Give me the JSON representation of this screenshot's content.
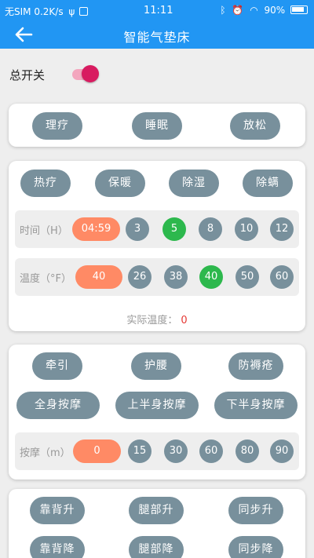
{
  "status_bar": {
    "carrier": "无SIM 0.2K/s",
    "time": "11:11",
    "battery": "90%"
  },
  "app_bar": {
    "title": "智能气垫床"
  },
  "master_switch": {
    "label": "总开关",
    "on": true
  },
  "mode_card": {
    "buttons": [
      "理疗",
      "睡眠",
      "放松"
    ]
  },
  "function_card": {
    "buttons": [
      "热疗",
      "保暖",
      "除湿",
      "除螨"
    ],
    "time_row": {
      "label": "时间（H）",
      "selected": "04:59",
      "options": [
        "3",
        "5",
        "8",
        "10",
        "12"
      ],
      "active": "5"
    },
    "temp_row": {
      "label": "温度（°F）",
      "selected": "40",
      "options": [
        "26",
        "38",
        "40",
        "50",
        "60"
      ],
      "active": "40"
    },
    "actual_temp": {
      "label": "实际温度：",
      "value": "0"
    }
  },
  "massage_card": {
    "row1": [
      "牵引",
      "护腰",
      "防褥疮"
    ],
    "row2": [
      "全身按摩",
      "上半身按摩",
      "下半身按摩"
    ],
    "massage_row": {
      "label": "按摩（m）",
      "selected": "0",
      "options": [
        "15",
        "30",
        "60",
        "80",
        "90"
      ]
    }
  },
  "lift_card": {
    "row1": [
      "靠背升",
      "腿部升",
      "同步升"
    ],
    "row2": [
      "靠背降",
      "腿部降",
      "同步降"
    ]
  },
  "colors": {
    "primary": "#2196f3",
    "button": "#78909c",
    "selected": "#ff8a65",
    "active": "#2db84d",
    "switch_on": "#d81b60",
    "warning_text": "#e53935"
  }
}
